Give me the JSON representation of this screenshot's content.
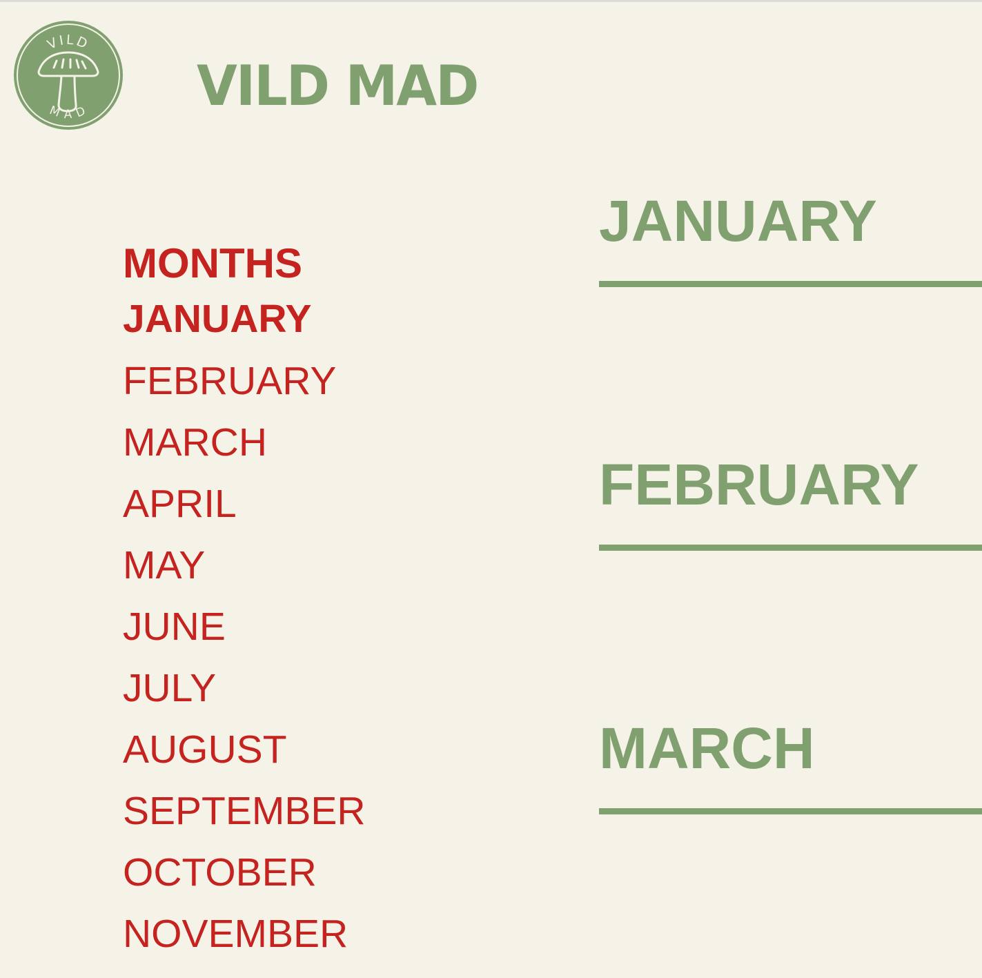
{
  "brand": {
    "name": "VILD MAD",
    "logo_text_top": "VILD",
    "logo_text_bottom": "MAD",
    "logo_icon": "mushroom-icon"
  },
  "colors": {
    "background": "#f5f2e7",
    "brand_green": "#80a070",
    "accent_red": "#c4231f"
  },
  "nav": {
    "heading": "MONTHS",
    "items": [
      {
        "label": "JANUARY",
        "active": true
      },
      {
        "label": "FEBRUARY"
      },
      {
        "label": "MARCH"
      },
      {
        "label": "APRIL"
      },
      {
        "label": "MAY"
      },
      {
        "label": "JUNE"
      },
      {
        "label": "JULY"
      },
      {
        "label": "AUGUST"
      },
      {
        "label": "SEPTEMBER"
      },
      {
        "label": "OCTOBER"
      },
      {
        "label": "NOVEMBER"
      }
    ]
  },
  "months": [
    {
      "title": "JANUARY"
    },
    {
      "title": "FEBRUARY"
    },
    {
      "title": "MARCH"
    }
  ]
}
